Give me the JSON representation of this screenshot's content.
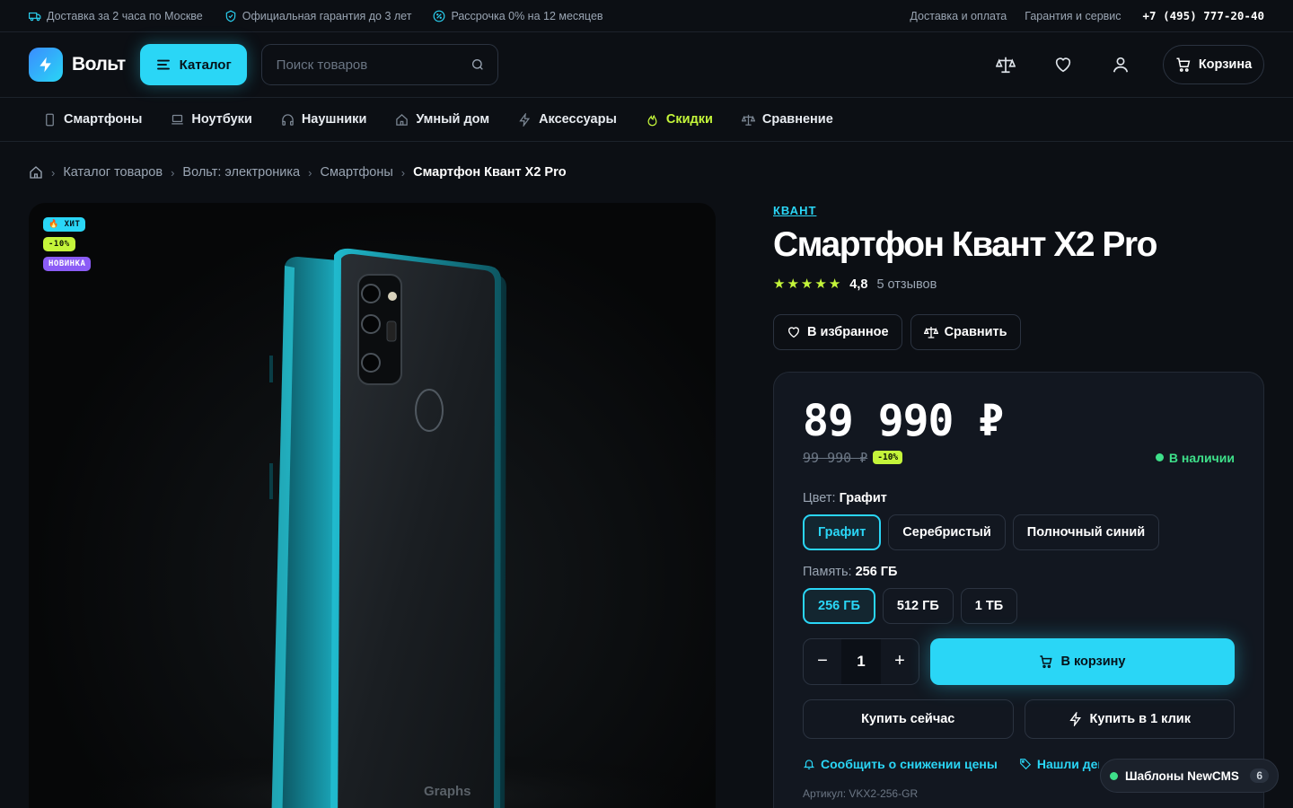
{
  "topbar": {
    "features": [
      "Доставка за 2 часа по Москве",
      "Официальная гарантия до 3 лет",
      "Рассрочка 0% на 12 месяцев"
    ],
    "links": [
      "Доставка и оплата",
      "Гарантия и сервис"
    ],
    "phone": "+7 (495) 777-20-40"
  },
  "header": {
    "logo": "Вольт",
    "catalog_label": "Каталог",
    "search_placeholder": "Поиск товаров",
    "cart_label": "Корзина"
  },
  "nav": {
    "items": [
      {
        "label": "Смартфоны",
        "icon": "smartphone-icon"
      },
      {
        "label": "Ноутбуки",
        "icon": "laptop-icon"
      },
      {
        "label": "Наушники",
        "icon": "headphones-icon"
      },
      {
        "label": "Умный дом",
        "icon": "home-icon"
      },
      {
        "label": "Аксессуары",
        "icon": "bolt-icon"
      },
      {
        "label": "Скидки",
        "icon": "fire-icon"
      },
      {
        "label": "Сравнение",
        "icon": "scales-icon"
      }
    ]
  },
  "breadcrumbs": [
    "Каталог товаров",
    "Вольт: электроника",
    "Смартфоны",
    "Смартфон Квант X2 Pro"
  ],
  "gallery": {
    "badges": [
      "ХИТ",
      "-10%",
      "НОВИНКА"
    ],
    "device_print": "Graphs"
  },
  "product": {
    "brand": "КВАНТ",
    "title": "Смартфон Квант X2 Pro",
    "rating_value": "4,8",
    "rating_stars": 5,
    "reviews": "5 отзывов",
    "favorite_label": "В избранное",
    "compare_label": "Сравнить",
    "price": "89 990 ₽",
    "old_price": "99 990 ₽",
    "discount": "-10%",
    "stock": "В наличии",
    "color_label": "Цвет:",
    "color_value": "Графит",
    "colors": [
      "Графит",
      "Серебристый",
      "Полночный синий"
    ],
    "memory_label": "Память:",
    "memory_value": "256 ГБ",
    "memories": [
      "256 ГБ",
      "512 ГБ",
      "1 ТБ"
    ],
    "quantity": "1",
    "add_to_cart": "В корзину",
    "buy_now": "Купить сейчас",
    "buy_one_click": "Купить в 1 клик",
    "notify_price": "Сообщить о снижении цены",
    "found_cheaper": "Нашли дешевле?",
    "sku": "Артикул: VKX2-256-GR"
  },
  "floating_widget": {
    "label": "Шаблоны NewCMS",
    "count": "6"
  },
  "colors": {
    "accent": "#2ad6f6",
    "lime": "#c4f53a",
    "purple": "#8b5cf6",
    "stock_green": "#3ee08a",
    "background": "#0c0f14"
  }
}
